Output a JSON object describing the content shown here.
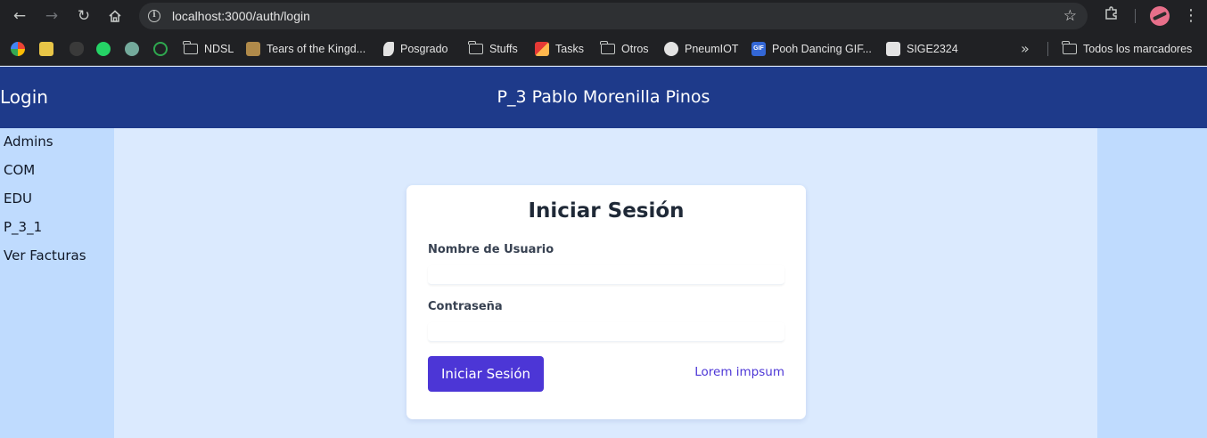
{
  "browser": {
    "url": "localhost:3000/auth/login",
    "bookmarks": [
      {
        "label": "",
        "icon": "google-icon"
      },
      {
        "label": "",
        "icon": "arrow-square-icon"
      },
      {
        "label": "",
        "icon": "penguin-icon"
      },
      {
        "label": "",
        "icon": "whatsapp-icon"
      },
      {
        "label": "",
        "icon": "chatgpt-icon"
      },
      {
        "label": "",
        "icon": "leaf-icon"
      },
      {
        "label": "NDSL",
        "icon": "folder-icon"
      },
      {
        "label": "Tears of the Kingd...",
        "icon": "zelda-icon"
      },
      {
        "label": "Posgrado",
        "icon": "feather-icon"
      },
      {
        "label": "Stuffs",
        "icon": "folder-icon"
      },
      {
        "label": "Tasks",
        "icon": "pen-icon"
      },
      {
        "label": "Otros",
        "icon": "folder-icon"
      },
      {
        "label": "PneumIOT",
        "icon": "github-icon"
      },
      {
        "label": "Pooh Dancing GIF...",
        "icon": "gif-icon"
      },
      {
        "label": "SIGE2324",
        "icon": "contact-icon"
      },
      {
        "label": "Todos los marcadores",
        "icon": "folder-icon"
      }
    ],
    "more_label": "»"
  },
  "header": {
    "logo": "Login",
    "title": "P_3 Pablo Morenilla Pinos"
  },
  "sidebar": {
    "items": [
      {
        "label": "Admins"
      },
      {
        "label": "COM"
      },
      {
        "label": "EDU"
      },
      {
        "label": "P_3_1"
      },
      {
        "label": "Ver Facturas"
      }
    ]
  },
  "login_form": {
    "title": "Iniciar Sesión",
    "username_label": "Nombre de Usuario",
    "username_value": "",
    "password_label": "Contraseña",
    "password_value": "",
    "submit_label": "Iniciar Sesión",
    "link_label": "Lorem impsum"
  },
  "colors": {
    "header_bg": "#1e3a8a",
    "sidebar_bg": "#bfdbfe",
    "main_bg": "#dbeafe",
    "accent": "#4c36d6"
  }
}
